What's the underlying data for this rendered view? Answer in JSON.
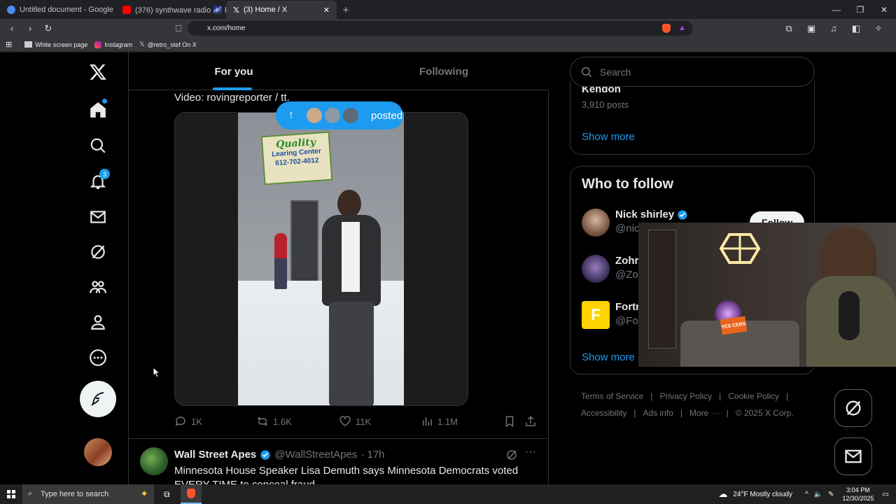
{
  "browser": {
    "tabs": [
      {
        "title": "Untitled document - Google Docs",
        "active": false
      },
      {
        "title": "(376) synthwave radio 🌌 beats t",
        "active": false
      },
      {
        "title": "(3) Home / X",
        "active": true
      }
    ],
    "url": "x.com/home",
    "bookmarks": [
      "White screen page",
      "Instagram",
      "@retro_stef On X"
    ]
  },
  "nav": {
    "notifications_badge": "3"
  },
  "feed": {
    "tab_for_you": "For you",
    "tab_following": "Following",
    "caption": "Video: rovingreporter / tt.",
    "posted_label": "posted",
    "video_sign_line1": "Quality",
    "video_sign_line2": "Learing Center",
    "video_sign_phone": "612-702-4012",
    "actions": {
      "replies": "1K",
      "reposts": "1.6K",
      "likes": "11K",
      "views": "1.1M"
    },
    "next_post": {
      "author": "Wall Street Apes",
      "handle": "@WallStreetApes",
      "time": "· 17h",
      "text": "Minnesota House Speaker Lisa Demuth says Minnesota Democrats voted EVERY TIME to conceal fraud"
    }
  },
  "right": {
    "search_placeholder": "Search",
    "trend_name": "Kendon",
    "trend_posts": "3,910 posts",
    "show_more": "Show more",
    "who_to_follow_title": "Who to follow",
    "follow_label": "Follow",
    "follows": [
      {
        "name": "Nick shirley",
        "handle": "@nic",
        "verified": true
      },
      {
        "name": "Zohr",
        "handle": "@Zo",
        "verified": false
      },
      {
        "name": "Fortn",
        "handle": "@For",
        "verified": false
      }
    ],
    "show_more_2": "Show more",
    "footer_row1": [
      "Terms of Service",
      "Privacy Policy",
      "Cookie Policy"
    ],
    "footer_row2": [
      "Accessibility",
      "Ads info",
      "More ···",
      "© 2025 X Corp."
    ]
  },
  "webcam": {
    "sign_text": "YES CERS"
  },
  "taskbar": {
    "search_placeholder": "Type here to search",
    "weather": "24°F  Mostly cloudy",
    "time": "3:04 PM",
    "date": "12/30/2025"
  },
  "colors": {
    "accent": "#1d9bf0",
    "background": "#000000",
    "border": "#2f3336",
    "muted": "#71767b"
  }
}
